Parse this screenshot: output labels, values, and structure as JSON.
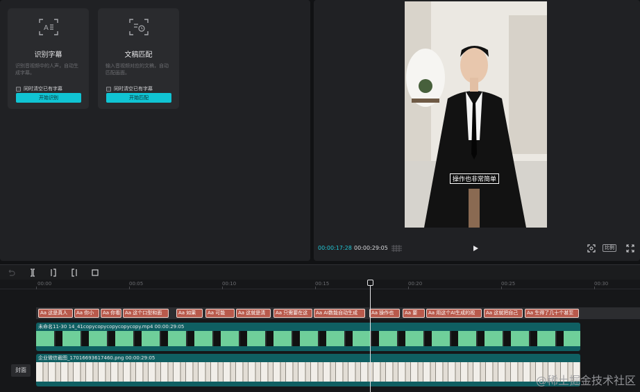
{
  "features": [
    {
      "title": "识别字幕",
      "description": "识别音视频中的人声，自动生成字幕。",
      "option": "同时清空已有字幕",
      "button": "开始识别"
    },
    {
      "title": "文稿匹配",
      "description": "输入音视频对应的文稿，自动匹配画面。",
      "option": "同时清空已有字幕",
      "button": "开始匹配"
    }
  ],
  "preview": {
    "caption": "操作也非常简单",
    "time_current": "00:00:17:28",
    "time_total": "00:00:29:05",
    "ratio": "比例"
  },
  "timeline": {
    "ruler_labels": [
      "00:00",
      "00:05",
      "00:10",
      "00:15",
      "00:20",
      "00:25",
      "00:30"
    ],
    "subtitle_clips": [
      "Aa 这是真人",
      "Aa 你小",
      "Aa 你看",
      "Aa 这个口型和面",
      "Aa 如果",
      "Aa 可能",
      "Aa 这就是清",
      "Aa 只需要在这",
      "Aa AI数能自动生成",
      "Aa 操作也",
      "Aa 要",
      "Aa 用这个AI生成的视",
      "Aa 这就把自己",
      "Aa 生得了几十个甚至"
    ],
    "video_track": {
      "file": "未命名11-30 14_41copycopycopycopycopy.mp4",
      "duration": "00:00:29:05"
    },
    "image_track": {
      "file": "企业微信截图_17016693617460.png",
      "duration": "00:00:29:05"
    },
    "cover_label": "封面"
  },
  "watermark": "@稀土掘金技术社区",
  "colors": {
    "accent": "#10c4d3",
    "subtitle_clip": "#b85a4c",
    "track": "#0f5f62"
  }
}
